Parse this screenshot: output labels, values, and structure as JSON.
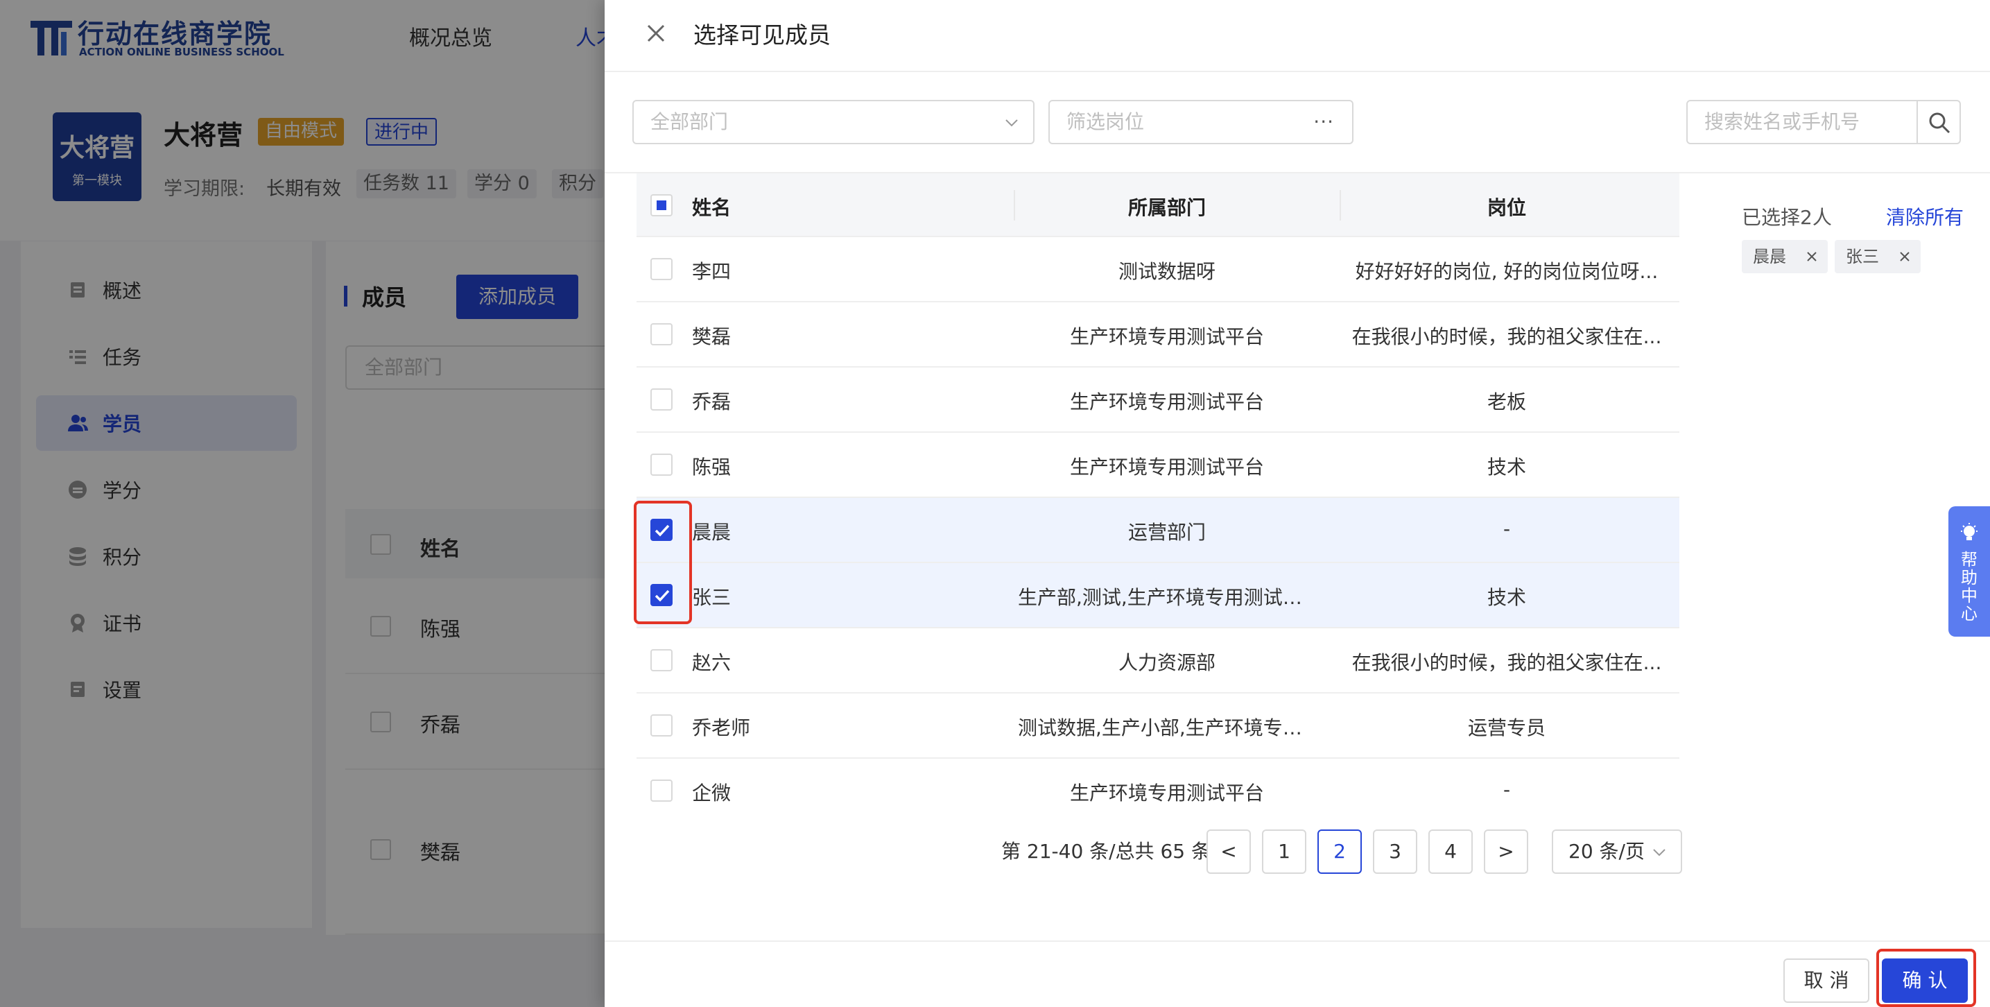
{
  "app": {
    "logo_cn": "行动在线商学院",
    "logo_en": "ACTION ONLINE BUSINESS SCHOOL",
    "nav": [
      "概况总览",
      "人才"
    ]
  },
  "course": {
    "cover_title": "大将营",
    "cover_sub": "第一模块",
    "title": "大将营",
    "tag_mode": "自由模式",
    "tag_status": "进行中",
    "period_label": "学习期限:",
    "period_value": "长期有效",
    "task_count": "任务数 11",
    "credit": "学分 0",
    "points": "积分"
  },
  "sidebar": {
    "items": [
      {
        "label": "概述",
        "icon": "overview-icon"
      },
      {
        "label": "任务",
        "icon": "task-icon"
      },
      {
        "label": "学员",
        "icon": "users-icon",
        "active": true
      },
      {
        "label": "学分",
        "icon": "credit-icon"
      },
      {
        "label": "积分",
        "icon": "points-icon"
      },
      {
        "label": "证书",
        "icon": "certificate-icon"
      },
      {
        "label": "设置",
        "icon": "settings-icon"
      }
    ]
  },
  "members": {
    "section_title": "成员",
    "add_button": "添加成员",
    "dept_placeholder": "全部部门",
    "col_name": "姓名",
    "rows": [
      "陈强",
      "乔磊",
      "樊磊"
    ]
  },
  "drawer": {
    "title": "选择可见成员",
    "dept_placeholder": "全部部门",
    "position_placeholder": "筛选岗位",
    "position_more": "···",
    "search_placeholder": "搜索姓名或手机号",
    "columns": {
      "name": "姓名",
      "dept": "所属部门",
      "position": "岗位"
    },
    "rows": [
      {
        "name": "李四",
        "dept": "测试数据呀",
        "position": "好好好好的岗位, 好的岗位岗位呀...",
        "checked": false
      },
      {
        "name": "樊磊",
        "dept": "生产环境专用测试平台",
        "position": "在我很小的时候，我的祖父家住在...",
        "checked": false
      },
      {
        "name": "乔磊",
        "dept": "生产环境专用测试平台",
        "position": "老板",
        "checked": false
      },
      {
        "name": "陈强",
        "dept": "生产环境专用测试平台",
        "position": "技术",
        "checked": false
      },
      {
        "name": "晨晨",
        "dept": "运营部门",
        "position": "-",
        "checked": true
      },
      {
        "name": "张三",
        "dept": "生产部,测试,生产环境专用测试平台",
        "position": "技术",
        "checked": true
      },
      {
        "name": "赵六",
        "dept": "人力资源部",
        "position": "在我很小的时候，我的祖父家住在...",
        "checked": false
      },
      {
        "name": "乔老师",
        "dept": "测试数据,生产小部,生产环境专用...",
        "position": "运营专员",
        "checked": false
      },
      {
        "name": "企微",
        "dept": "生产环境专用测试平台",
        "position": "-",
        "checked": false
      }
    ],
    "pagination": {
      "info": "第 21-40 条/总共 65 条",
      "prev": "<",
      "pages": [
        "1",
        "2",
        "3",
        "4"
      ],
      "current": "2",
      "next": ">",
      "page_size": "20 条/页"
    },
    "selected_label": "已选择2人",
    "clear_all": "清除所有",
    "chips": [
      "晨晨",
      "张三"
    ],
    "cancel": "取 消",
    "confirm": "确 认"
  },
  "help": {
    "label": "帮助中心"
  },
  "colors": {
    "primary": "#2646d8",
    "highlight": "#e33426",
    "tag_free": "#e8a52b"
  }
}
